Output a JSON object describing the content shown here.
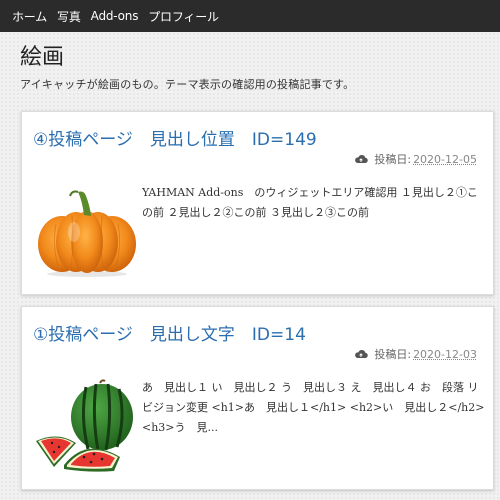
{
  "nav": {
    "items": [
      {
        "label": "ホーム"
      },
      {
        "label": "写真"
      },
      {
        "label": "Add-ons"
      },
      {
        "label": "プロフィール"
      }
    ]
  },
  "page": {
    "title": "絵画",
    "description": "アイキャッチが絵画のもの。テーマ表示の確認用の投稿記事です。"
  },
  "posts": [
    {
      "title": "④投稿ページ　見出し位置　ID=149",
      "date_label": "投稿日:",
      "date": "2020-12-05",
      "excerpt": "YAHMAN Add-ons　のウィジェットエリア確認用 １見出し２①この前 ２見出し２②この前 ３見出し２③この前",
      "thumbnail_icon": "pumpkin-image"
    },
    {
      "title": "①投稿ページ　見出し文字　ID=14",
      "date_label": "投稿日:",
      "date": "2020-12-03",
      "excerpt": "あ　見出し１ い　見出し２ う　見出し３ え　見出し４ お　段落 リビジョン変更 <h1>あ　見出し１</h1> <h2>い　見出し２</h2> <h3>う　見...",
      "thumbnail_icon": "watermelon-image"
    }
  ],
  "colors": {
    "nav_bg": "#2b2b2b",
    "title_link": "#2a6eb0",
    "page_bg": "#f1f1f1"
  }
}
